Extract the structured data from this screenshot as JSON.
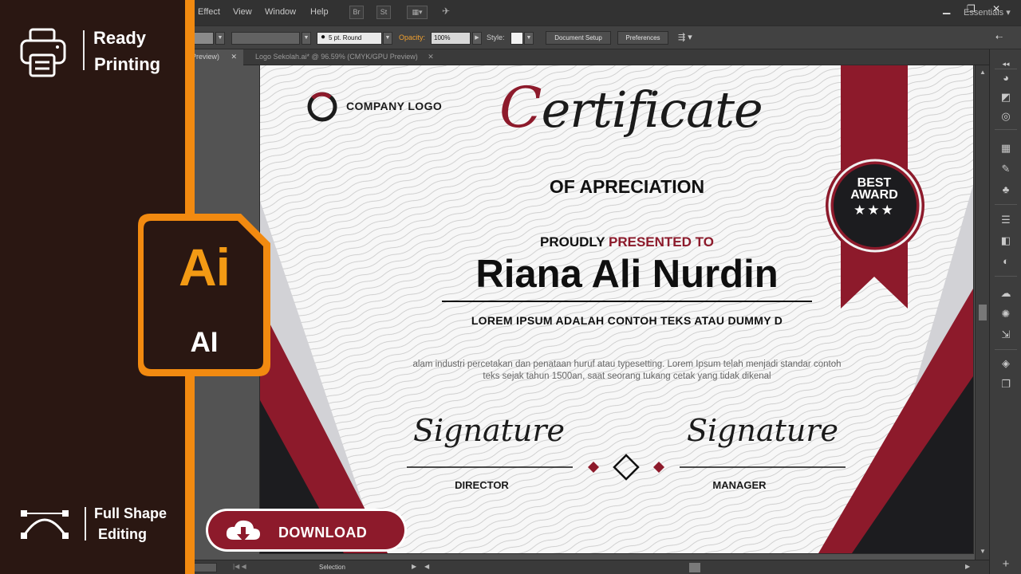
{
  "menubar": {
    "items": [
      "Effect",
      "View",
      "Window",
      "Help"
    ],
    "workspace": "Essentials",
    "window_controls": [
      "minimize-icon",
      "restore-icon",
      "close-icon"
    ]
  },
  "controlbar": {
    "stroke_profile": "5 pt. Round",
    "opacity_label": "Opacity:",
    "opacity_value": "100%",
    "style_label": "Style:",
    "document_setup": "Document Setup",
    "preferences": "Preferences"
  },
  "tabs": [
    {
      "label": "Preview)"
    },
    {
      "label": "Logo Sekolah.ai* @ 96.59% (CMYK/GPU Preview)"
    }
  ],
  "status": {
    "tool": "Selection"
  },
  "certificate": {
    "company_logo": "COMPANY LOGO",
    "title_first_letter": "C",
    "title_rest": "ertificate",
    "subtitle": "OF APRECIATION",
    "presented_prefix": "PROUDLY ",
    "presented_accent": "PRESENTED TO",
    "recipient": "Riana Ali Nurdin",
    "lorem_heading": "LOREM IPSUM ADALAH CONTOH TEKS ATAU DUMMY D",
    "body": "alam industri percetakan dan penataan huruf atau typesetting. Lorem Ipsum telah menjadi standar contoh teks sejak tahun 1500an, saat seorang tukang cetak yang tidak dikenal",
    "signature_left": "Signature",
    "signature_right": "Signature",
    "role_left": "DIRECTOR",
    "role_right": "MANAGER",
    "award_line1": "BEST",
    "award_line2": "AWARD",
    "award_stars": "★★★",
    "colors": {
      "accent": "#8d1a2b",
      "dark": "#1c1c1f"
    }
  },
  "promo": {
    "ready_line1": "Ready",
    "ready_line2": "Printing",
    "ai_logo": "Ai",
    "ai_label": "AI",
    "shape_line1": "Full Shape",
    "shape_line2": "Editing",
    "download_label": "DOWNLOAD",
    "accent_color": "#f28a10"
  }
}
